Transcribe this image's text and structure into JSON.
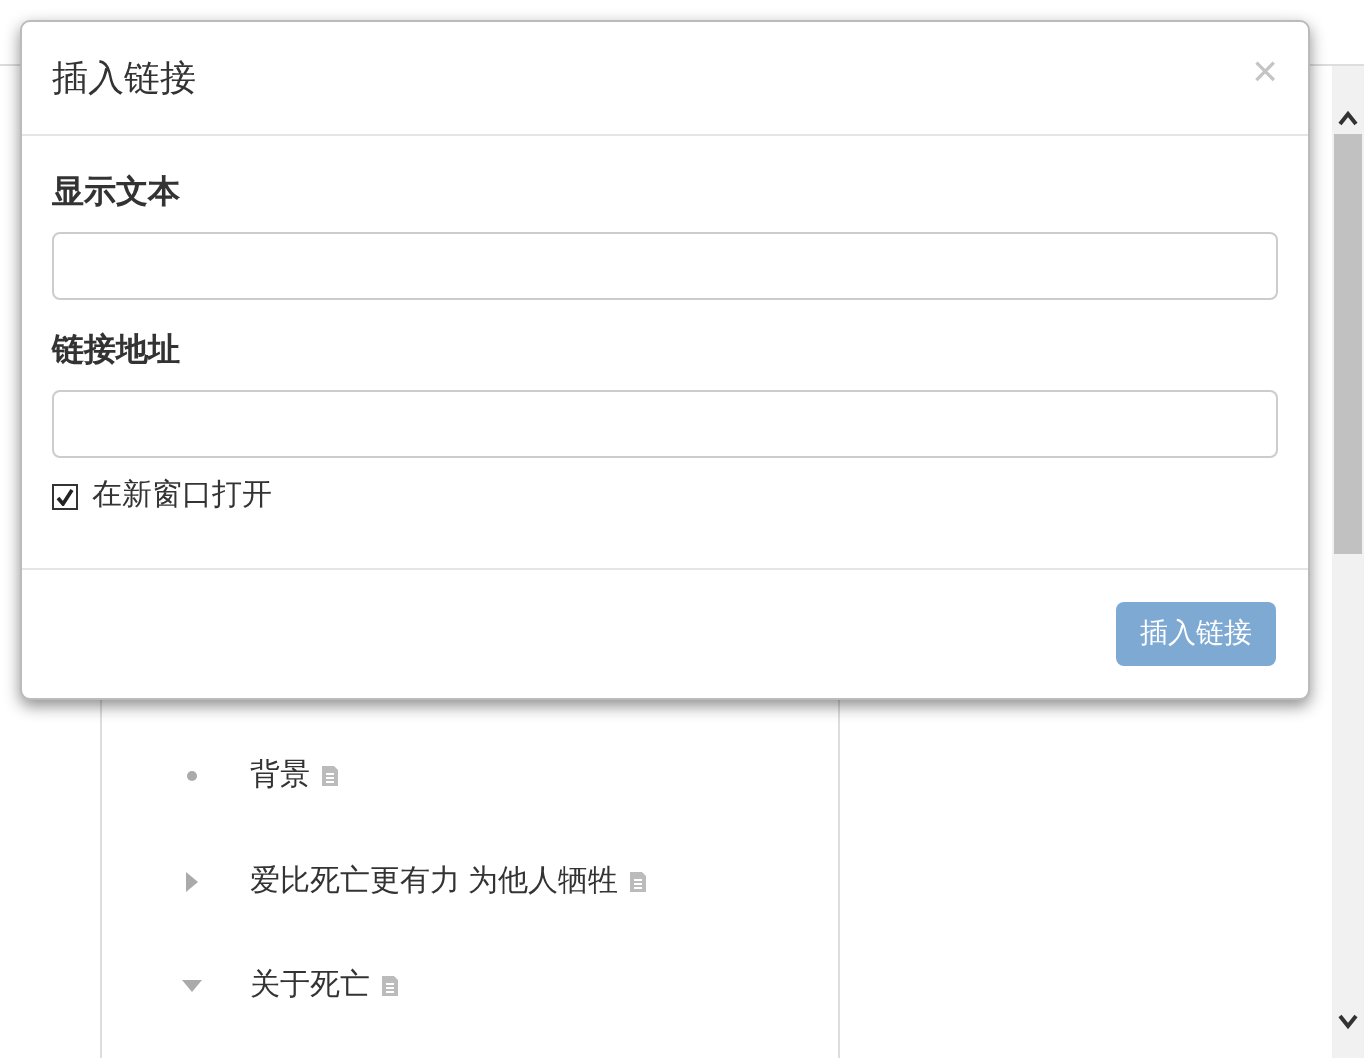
{
  "outline": {
    "items": [
      {
        "kind": "leaf",
        "label": "背景"
      },
      {
        "kind": "collapsed",
        "label": "爱比死亡更有力 为他人牺牲"
      },
      {
        "kind": "expanded",
        "label": "关于死亡"
      }
    ]
  },
  "dialog": {
    "title": "插入链接",
    "close": "×",
    "fields": [
      {
        "label": "显示文本"
      },
      {
        "label": "链接地址"
      }
    ],
    "open_in_new_window": {
      "label": "在新窗口打开",
      "checked": true
    },
    "submit": {
      "label": "插入链接",
      "disabled": true
    }
  }
}
